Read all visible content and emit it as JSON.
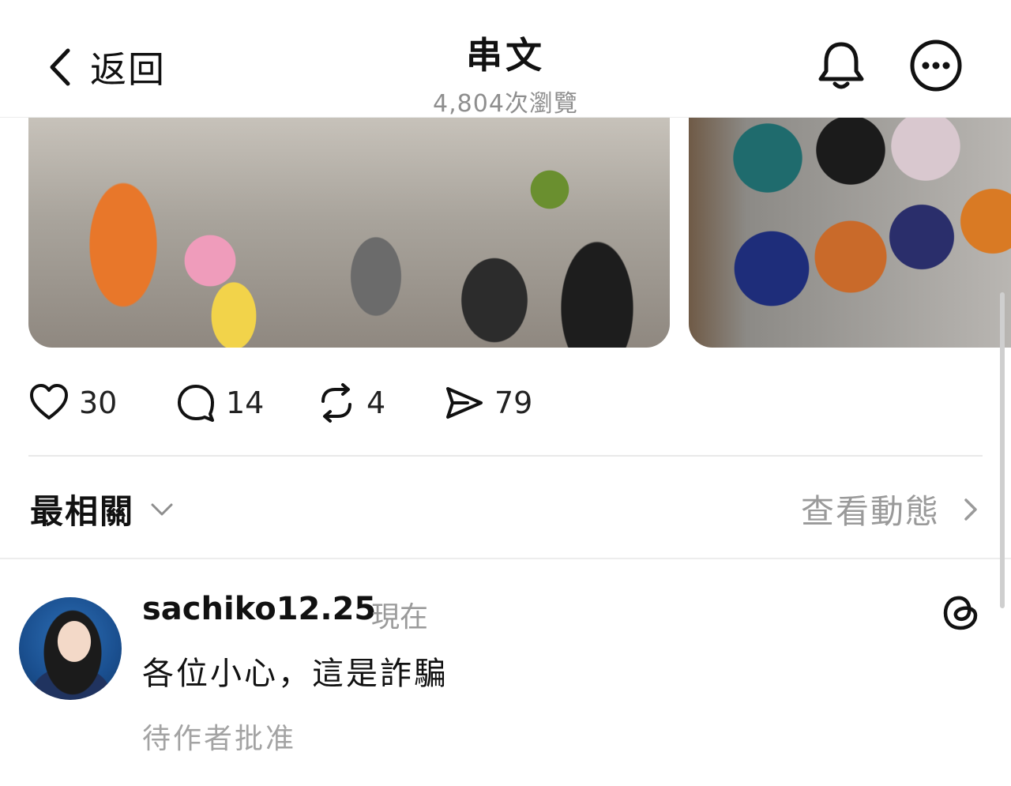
{
  "header": {
    "back_label": "返回",
    "title": "串文",
    "views": "4,804次瀏覽",
    "icons": [
      "chevron-left-icon",
      "bell-icon",
      "more-icon"
    ]
  },
  "post": {
    "images": [
      "photo-halloween-costumes",
      "photo-basketballs-rack"
    ],
    "actions": {
      "likes": "30",
      "comments": "14",
      "reposts": "4",
      "shares": "79"
    }
  },
  "replies_section": {
    "sort_label": "最相關",
    "activity_label": "查看動態"
  },
  "reply": {
    "username": "sachiko12.25",
    "time": "現在",
    "text": "各位小心，這是詐騙",
    "status": "待作者批准"
  }
}
